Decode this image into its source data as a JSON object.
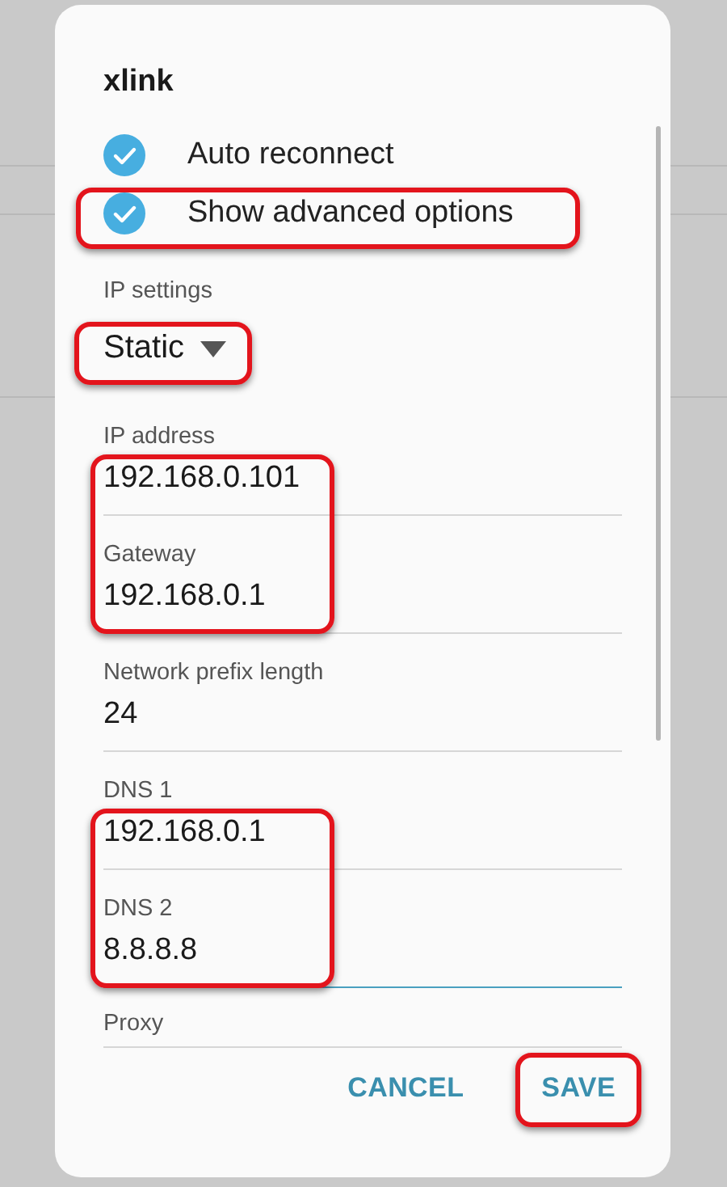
{
  "dialog": {
    "title": "xlink",
    "checkboxes": [
      {
        "label": "Auto reconnect",
        "checked": true,
        "highlighted": false
      },
      {
        "label": "Show advanced options",
        "checked": true,
        "highlighted": true
      }
    ],
    "ip_settings": {
      "label": "IP settings",
      "value": "Static",
      "highlighted": true
    },
    "field_groups": [
      {
        "highlighted": true,
        "fields": [
          {
            "label": "IP address",
            "value": "192.168.0.101",
            "focused": false
          },
          {
            "label": "Gateway",
            "value": "192.168.0.1",
            "focused": false
          }
        ]
      },
      {
        "highlighted": false,
        "fields": [
          {
            "label": "Network prefix length",
            "value": "24",
            "focused": false
          }
        ]
      },
      {
        "highlighted": true,
        "fields": [
          {
            "label": "DNS 1",
            "value": "192.168.0.1",
            "focused": false
          },
          {
            "label": "DNS 2",
            "value": "8.8.8.8",
            "focused": true
          }
        ]
      }
    ],
    "proxy": {
      "label": "Proxy"
    },
    "buttons": [
      {
        "label": "CANCEL",
        "highlighted": false
      },
      {
        "label": "SAVE",
        "highlighted": true
      }
    ]
  }
}
